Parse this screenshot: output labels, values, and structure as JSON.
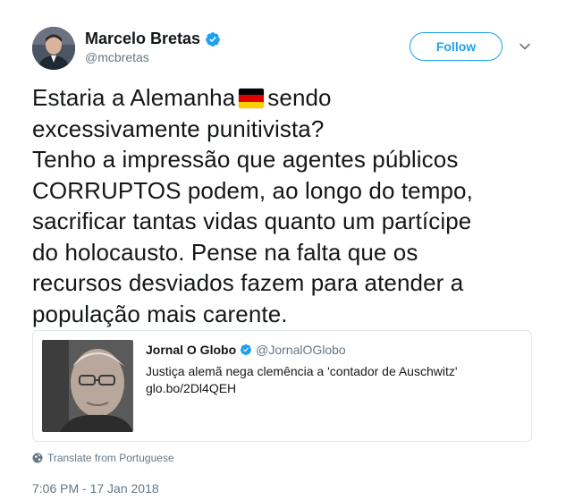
{
  "author": {
    "name": "Marcelo Bretas",
    "handle": "@mcbretas"
  },
  "follow_label": "Follow",
  "tweet": {
    "line1_before_flag": "Estaria a Alemanha",
    "line1_after_flag": "sendo",
    "rest": "excessivamente punitivista?\nTenho a impressão que agentes públicos\nCORRUPTOS podem, ao longo do tempo,\nsacrificar tantas vidas quanto um partícipe\ndo holocausto. Pense na falta que os\nrecursos desviados fazem para atender a\npopulação mais carente."
  },
  "quoted": {
    "name": "Jornal O Globo",
    "handle": "@JornalOGlobo",
    "text": "Justiça alemã nega clemência a 'contador de Auschwitz'",
    "link": "glo.bo/2Dl4QEH"
  },
  "translate_label": "Translate from Portuguese",
  "timestamp": "7:06 PM - 17 Jan 2018",
  "icons": [
    "verified-badge-icon",
    "chevron-down-icon",
    "germany-flag-emoji",
    "globe-icon"
  ],
  "colors": {
    "accent": "#1da1f2",
    "text": "#14171a",
    "secondary": "#657786",
    "border": "#e1e8ed"
  }
}
